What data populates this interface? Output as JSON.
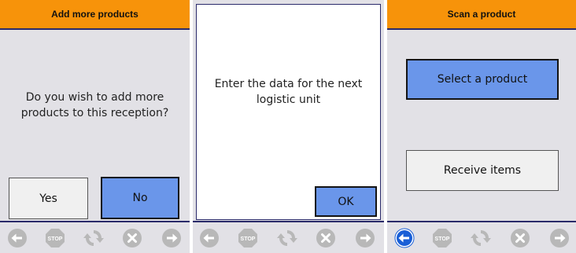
{
  "screen1": {
    "title": "Add more products",
    "message": "Do you wish to add more products to this reception?",
    "yes_label": "Yes",
    "no_label": "No"
  },
  "screen2": {
    "message": "Enter the data for the next logistic unit",
    "ok_label": "OK"
  },
  "screen3": {
    "title": "Scan a product",
    "select_label": "Select a product",
    "receive_label": "Receive items"
  },
  "toolbar": {
    "stop_label": "STOP",
    "icons": [
      "back-arrow-icon",
      "stop-icon",
      "refresh-icon",
      "cancel-icon",
      "forward-arrow-icon"
    ]
  },
  "colors": {
    "header": "#f7930a",
    "accent_blue": "#6a96ea",
    "active_nav_blue": "#1a5fd6",
    "disabled_gray": "#b8b8b8",
    "screen_bg": "#e2e1e6"
  }
}
